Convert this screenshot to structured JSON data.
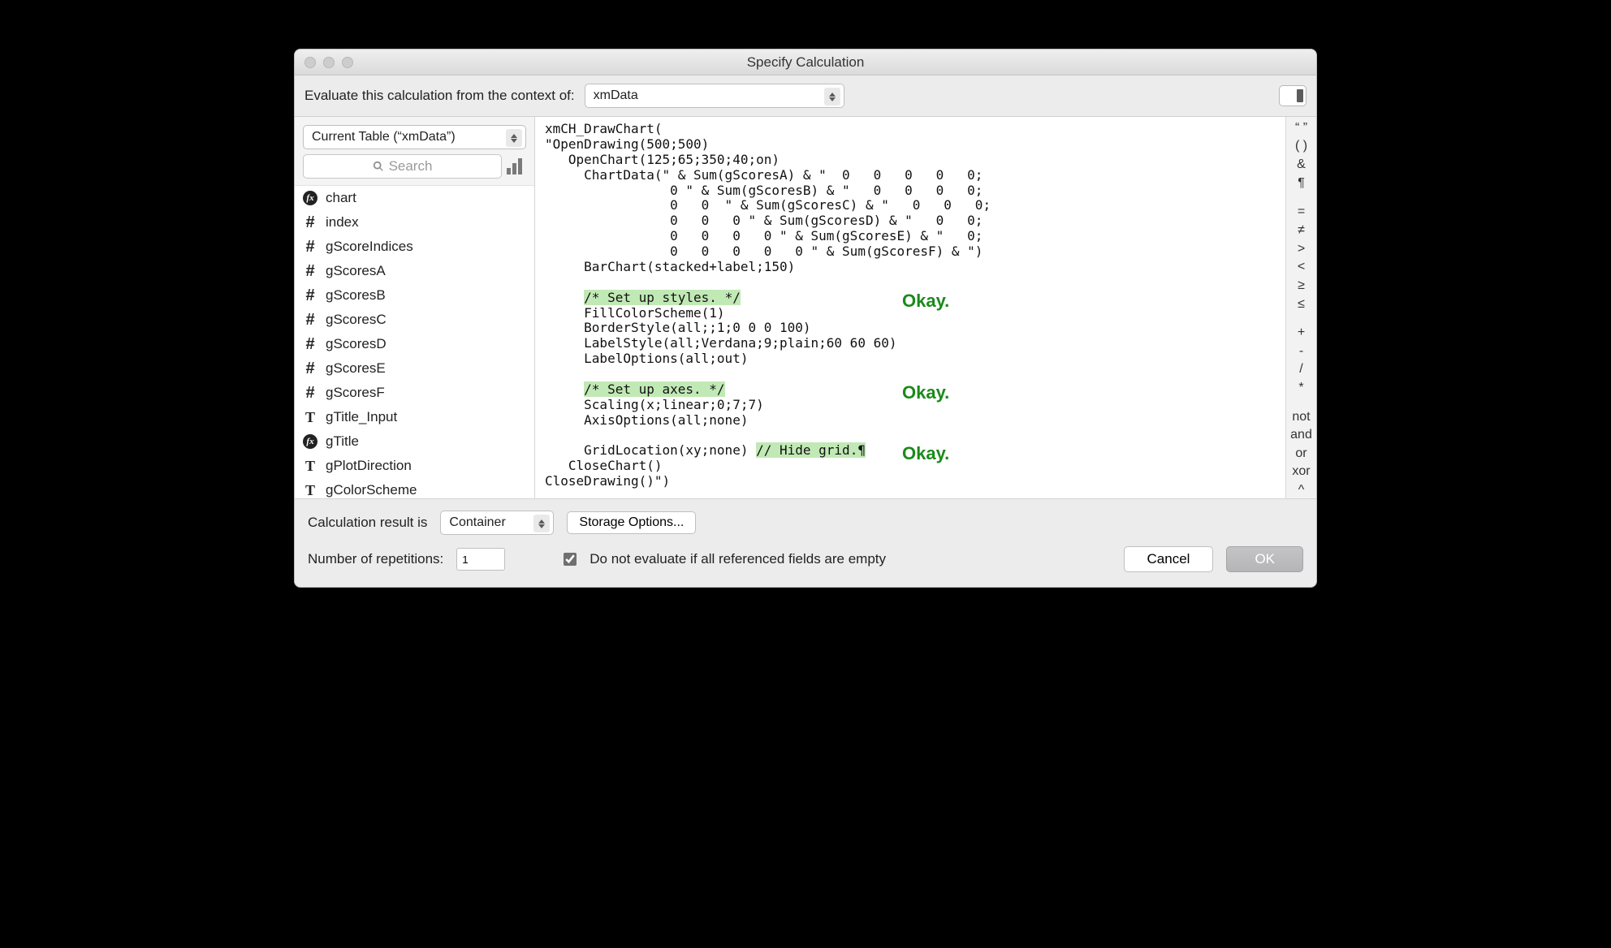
{
  "window_title": "Specify Calculation",
  "toolbar": {
    "context_label": "Evaluate this calculation from the context of:",
    "context_value": "xmData"
  },
  "sidebar": {
    "table_selector": "Current Table (“xmData”)",
    "search_placeholder": "Search",
    "fields": [
      {
        "icon": "fx",
        "name": "chart"
      },
      {
        "icon": "hash",
        "name": "index"
      },
      {
        "icon": "hash",
        "name": "gScoreIndices"
      },
      {
        "icon": "hash",
        "name": "gScoresA"
      },
      {
        "icon": "hash",
        "name": "gScoresB"
      },
      {
        "icon": "hash",
        "name": "gScoresC"
      },
      {
        "icon": "hash",
        "name": "gScoresD"
      },
      {
        "icon": "hash",
        "name": "gScoresE"
      },
      {
        "icon": "hash",
        "name": "gScoresF"
      },
      {
        "icon": "T",
        "name": "gTitle_Input"
      },
      {
        "icon": "fx",
        "name": "gTitle"
      },
      {
        "icon": "T",
        "name": "gPlotDirection"
      },
      {
        "icon": "T",
        "name": "gColorScheme"
      }
    ]
  },
  "editor": {
    "lines": [
      "xmCH_DrawChart(",
      "\"OpenDrawing(500;500)",
      "   OpenChart(125;65;350;40;on)",
      "     ChartData(\" & Sum(gScoresA) & \"  0   0   0   0   0;",
      "                0 \" & Sum(gScoresB) & \"   0   0   0   0;",
      "                0   0  \" & Sum(gScoresC) & \"   0   0   0;",
      "                0   0   0 \" & Sum(gScoresD) & \"   0   0;",
      "                0   0   0   0 \" & Sum(gScoresE) & \"   0;",
      "                0   0   0   0   0 \" & Sum(gScoresF) & \")",
      "     BarChart(stacked+label;150)",
      "",
      "     /* Set up styles. */",
      "     FillColorScheme(1)",
      "     BorderStyle(all;;1;0 0 0 100)",
      "     LabelStyle(all;Verdana;9;plain;60 60 60)",
      "     LabelOptions(all;out)",
      "",
      "     /* Set up axes. */",
      "     Scaling(x;linear;0;7;7)",
      "     AxisOptions(all;none)",
      "",
      "     GridLocation(xy;none) // Hide grid.¶",
      "   CloseChart()",
      "CloseDrawing()\")"
    ],
    "comment1": "/* Set up styles. */",
    "comment2": "/* Set up axes. */",
    "comment3": "// Hide grid.¶",
    "okay": "Okay."
  },
  "operators": [
    "“ ”",
    "( )",
    "&",
    "¶",
    "",
    "=",
    "≠",
    ">",
    "<",
    "≥",
    "≤",
    "",
    "+",
    "-",
    "/",
    "*",
    "",
    "not",
    "and",
    "or",
    "xor",
    "^"
  ],
  "footer": {
    "result_label": "Calculation result is",
    "result_type": "Container",
    "storage_btn": "Storage Options...",
    "reps_label": "Number of repetitions:",
    "reps_value": "1",
    "checkbox_label": "Do not evaluate if all referenced fields are empty",
    "cancel": "Cancel",
    "ok": "OK"
  }
}
